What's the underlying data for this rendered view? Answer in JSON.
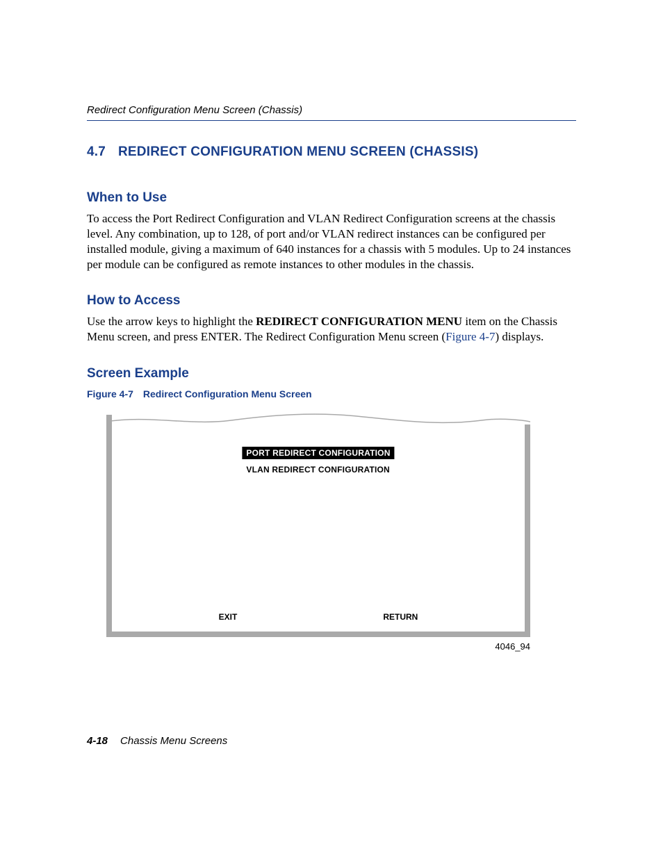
{
  "header": {
    "running_title": "Redirect Configuration Menu Screen (Chassis)"
  },
  "section": {
    "number": "4.7",
    "title": "REDIRECT CONFIGURATION MENU SCREEN (CHASSIS)"
  },
  "when_to_use": {
    "heading": "When to Use",
    "text": "To access the Port Redirect Configuration and VLAN Redirect Configuration screens at the chassis level. Any combination, up to 128, of port and/or VLAN redirect instances can be configured per installed module, giving a maximum of 640 instances for a chassis with 5 modules. Up to 24 instances per module can be configured as remote instances to other modules in the chassis."
  },
  "how_to_access": {
    "heading": "How to Access",
    "pre": "Use the arrow keys to highlight the ",
    "bold": "REDIRECT CONFIGURATION MENU",
    "mid": " item on the Chassis Menu screen, and press ENTER. The Redirect Configuration Menu screen (",
    "xref": "Figure 4-7",
    "post": ") displays."
  },
  "screen_example": {
    "heading": "Screen Example",
    "caption_num": "Figure 4-7",
    "caption_title": "Redirect Configuration Menu Screen"
  },
  "screen": {
    "menu": {
      "selected": "PORT REDIRECT CONFIGURATION",
      "unselected": "VLAN REDIRECT CONFIGURATION"
    },
    "buttons": {
      "exit": "EXIT",
      "return": "RETURN"
    },
    "figure_id": "4046_94"
  },
  "footer": {
    "page_number": "4-18",
    "chapter": "Chassis Menu Screens"
  }
}
